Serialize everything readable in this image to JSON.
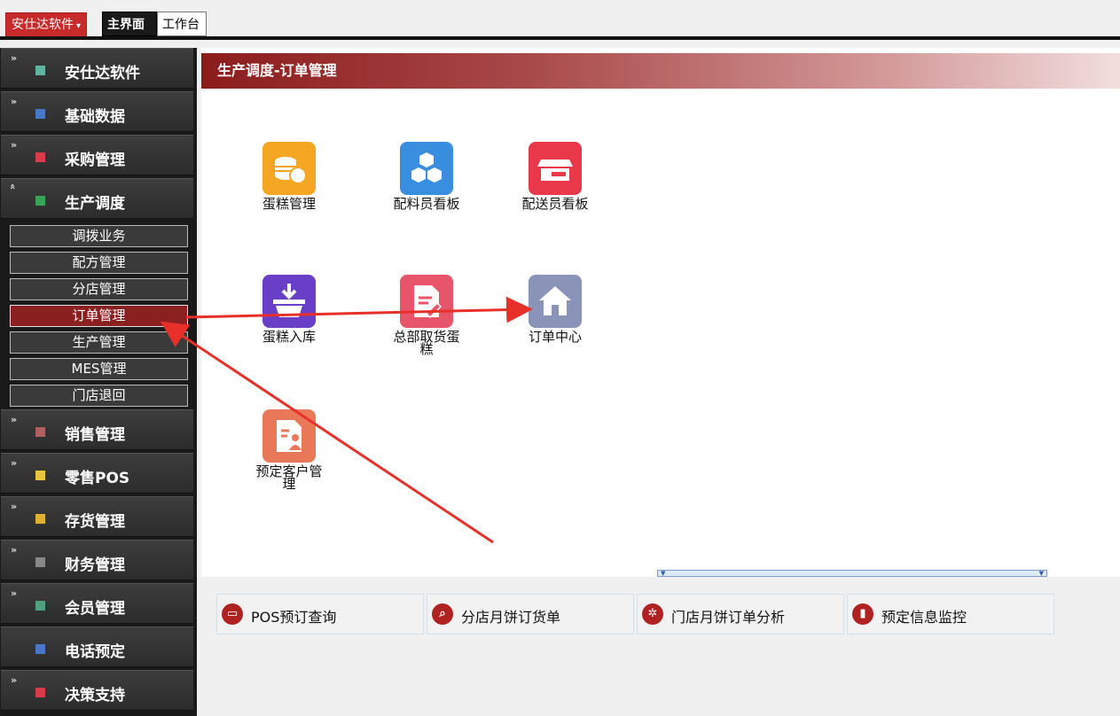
{
  "topbar": {
    "brand_label": "安仕达软件",
    "brand_caret": "▾",
    "tabs": [
      {
        "label": "主界面",
        "active": true
      },
      {
        "label": "工作台",
        "active": false
      }
    ]
  },
  "sidebar": {
    "items": [
      {
        "label": "安仕达软件",
        "arrow": "»",
        "color": "#5fb4a0"
      },
      {
        "label": "基础数据",
        "arrow": "»",
        "color": "#4a78c8"
      },
      {
        "label": "采购管理",
        "arrow": "»",
        "color": "#d83c4a"
      },
      {
        "label": "生产调度",
        "arrow": "«",
        "color": "#3aa35a",
        "expanded": true
      },
      {
        "label": "销售管理",
        "arrow": "»",
        "color": "#b06060"
      },
      {
        "label": "零售POS",
        "arrow": "»",
        "color": "#e8c440"
      },
      {
        "label": "存货管理",
        "arrow": "»",
        "color": "#e0b030"
      },
      {
        "label": "财务管理",
        "arrow": "»",
        "color": "#888888"
      },
      {
        "label": "会员管理",
        "arrow": "»",
        "color": "#50a080"
      },
      {
        "label": "电话预定",
        "arrow": "",
        "color": "#4a78c8"
      },
      {
        "label": "决策支持",
        "arrow": "»",
        "color": "#d83c4a"
      }
    ],
    "sub_items": [
      {
        "label": "调拨业务",
        "active": false
      },
      {
        "label": "配方管理",
        "active": false
      },
      {
        "label": "分店管理",
        "active": false
      },
      {
        "label": "订单管理",
        "active": true
      },
      {
        "label": "生产管理",
        "active": false
      },
      {
        "label": "MES管理",
        "active": false
      },
      {
        "label": "门店退回",
        "active": false
      }
    ]
  },
  "panel": {
    "title": "生产调度-订单管理",
    "apps": [
      {
        "label": "蛋糕管理",
        "icon": "coins-icon",
        "color": "#f5a623"
      },
      {
        "label": "配料员看板",
        "icon": "boxes-icon",
        "color": "#3a8ee0"
      },
      {
        "label": "配送员看板",
        "icon": "truck-icon",
        "color": "#e8384a"
      },
      {
        "label": "蛋糕入库",
        "icon": "basket-icon",
        "color": "#6a3fc8"
      },
      {
        "label": "总部取货蛋",
        "label2": "糕",
        "icon": "document-edit-icon",
        "color": "#e8546a"
      },
      {
        "label": "订单中心",
        "icon": "home-icon",
        "color": "#8a93b8"
      },
      {
        "label": "预定客户管",
        "label2": "理",
        "icon": "customer-document-icon",
        "color": "#e87858"
      }
    ]
  },
  "quick": {
    "items": [
      {
        "label": "POS预订查询",
        "icon": "monitor-icon",
        "glyph": "▭"
      },
      {
        "label": "分店月饼订货单",
        "icon": "search-icon",
        "glyph": "⌕"
      },
      {
        "label": "门店月饼订单分析",
        "icon": "basketball-icon",
        "glyph": "✲"
      },
      {
        "label": "预定信息监控",
        "icon": "bar-chart-icon",
        "glyph": "▮"
      }
    ]
  },
  "colors": {
    "accent": "#c62a2a",
    "annotation_arrow": "#e8302a"
  }
}
